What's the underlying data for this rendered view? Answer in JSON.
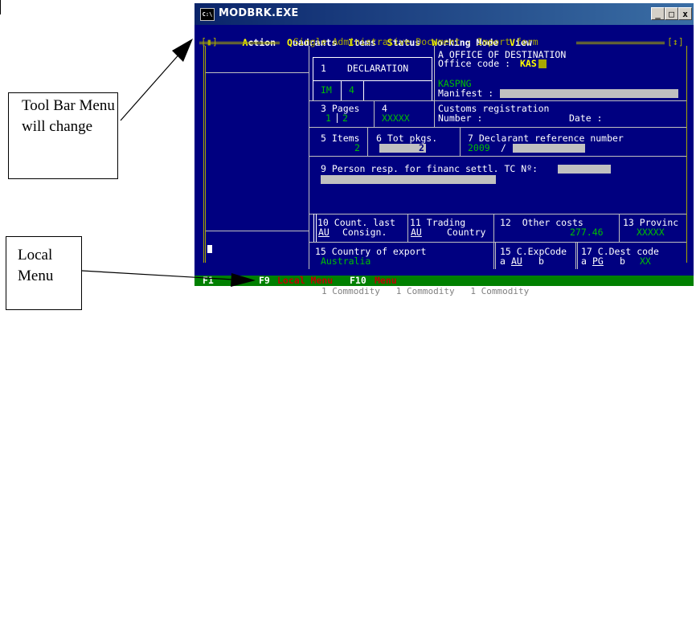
{
  "window": {
    "title": "MODBRK.EXE",
    "icon_text": "C:\\",
    "buttons": {
      "minimize": "_",
      "maximize": "□",
      "close": "x"
    }
  },
  "menu": [
    {
      "hot": "A",
      "rest": "ction"
    },
    {
      "hot": "Q",
      "rest": "uadrants"
    },
    {
      "hot": "I",
      "rest": "tems"
    },
    {
      "hot": "S",
      "rest": "tatus"
    },
    {
      "hot": "W",
      "rest": "orking Mode"
    },
    {
      "hot": "V",
      "rest": "iew"
    }
  ],
  "form_title": "Single Administrative Document - Import form",
  "frame_left_marker": "[▮]",
  "frame_right_marker": "[↕]",
  "boxes": {
    "declaration": {
      "num": "1",
      "label": "DECLARATION",
      "val1": "IM",
      "val2": "4"
    },
    "office": {
      "label": "A OFFICE OF DESTINATION",
      "code_label": "Office code : ",
      "code": "KAS",
      "office_name": "KASPNG",
      "manifest_label": "Manifest : "
    },
    "pages": {
      "label": "3 Pages",
      "v1": "1",
      "v2": "2"
    },
    "forms": {
      "label": "4",
      "value": "XXXXX"
    },
    "customs": {
      "label": "Customs registration",
      "number": "Number :",
      "date": "Date :"
    },
    "items": {
      "label": "5 Items",
      "value": "2"
    },
    "pkgs": {
      "label": "6 Tot pkgs.",
      "value": "2"
    },
    "declarant": {
      "label": "7 Declarant reference number",
      "year": "2009",
      "sep": "/"
    },
    "person": {
      "label": "9 Person resp. for financ settl. TC Nº:"
    },
    "country_last": {
      "label": "10 Count. last",
      "sub": "Consign.",
      "code": "AU"
    },
    "trading": {
      "label": "11 Trading",
      "sub": "Country",
      "code": "AU"
    },
    "other_costs": {
      "label": "12  Other costs",
      "value": "277.46"
    },
    "province": {
      "label": "13 Provinc",
      "value": "XXXXX"
    },
    "export": {
      "label": "15 Country of export",
      "value": "Australia"
    },
    "exp_code": {
      "label": "15 C.ExpCode",
      "a": "a",
      "a_val": "AU",
      "b": "b"
    },
    "dest_code": {
      "label": "17 C.Dest code",
      "a": "a",
      "a_val": "PG",
      "b": "b",
      "b_val": "XX"
    }
  },
  "statusbar": [
    {
      "key": "F1",
      "label": "  "
    },
    {
      "key": "F9",
      "label": "Local Menu"
    },
    {
      "key": "F10",
      "label": "Menu"
    }
  ],
  "callouts": {
    "toolbar": "Tool Bar Menu will change",
    "local": "Local Menu"
  },
  "below_text": "1 Commodity   1 Commodity   1 Commodity"
}
